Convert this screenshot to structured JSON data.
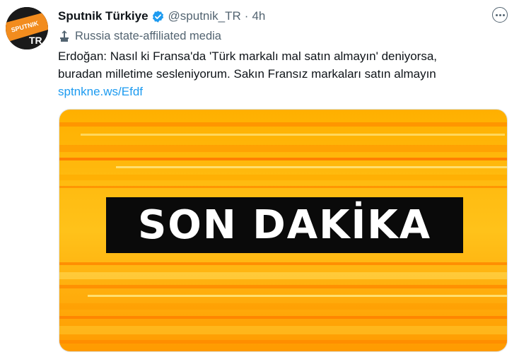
{
  "account": {
    "display_name": "Sputnik Türkiye",
    "handle": "@sputnik_TR",
    "separator": "·",
    "time": "4h",
    "affiliation_label": "Russia state-affiliated media",
    "avatar_brand_text": "SPUTNIK",
    "avatar_region_text": "TR"
  },
  "tweet": {
    "text_lines": [
      "Erdoğan: Nasıl ki Fransa'da 'Türk markalı mal satın almayın' deniyorsa,",
      "buradan milletime sesleniyorum. Sakın Fransız markaları satın almayın"
    ],
    "link": "sptnkne.ws/Efdf"
  },
  "media": {
    "banner_text": "SON DAKİKA"
  },
  "colors": {
    "link": "#1d9bf0",
    "verified": "#1d9bf0",
    "secondary_text": "#536471",
    "primary_text": "#0f1419",
    "banner_background": "#ffa500",
    "avatar_orange": "#f28c1e"
  },
  "icons": {
    "verified": "verified-badge-icon",
    "affiliation": "state-affiliated-podium-icon",
    "more": "more-options-icon"
  }
}
